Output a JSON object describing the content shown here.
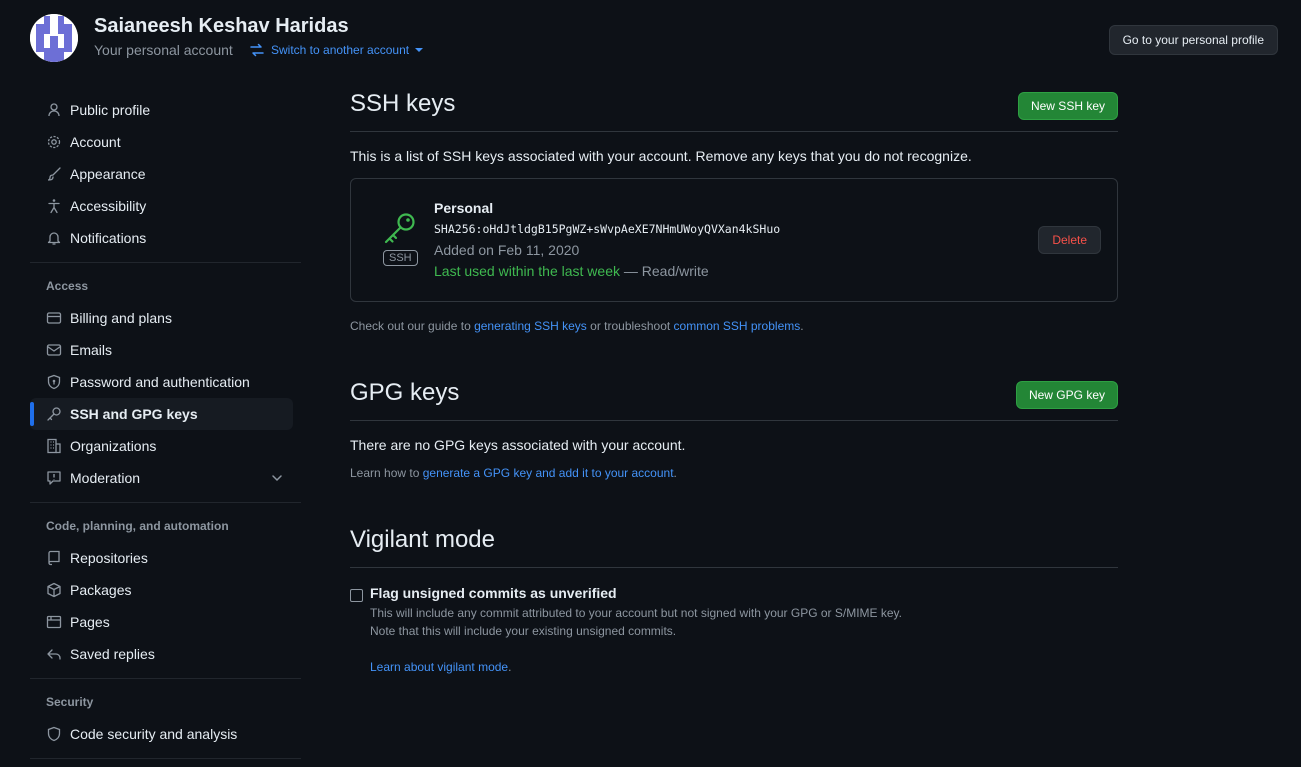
{
  "header": {
    "account_name": "Saianeesh Keshav Haridas",
    "account_sub": "Your personal account",
    "switch_label": "Switch to another account",
    "profile_button": "Go to your personal profile"
  },
  "sidebar": {
    "top_items": [
      {
        "label": "Public profile",
        "icon": "person-icon"
      },
      {
        "label": "Account",
        "icon": "gear-icon"
      },
      {
        "label": "Appearance",
        "icon": "paintbrush-icon"
      },
      {
        "label": "Accessibility",
        "icon": "accessibility-icon"
      },
      {
        "label": "Notifications",
        "icon": "bell-icon"
      }
    ],
    "access_heading": "Access",
    "access_items": [
      {
        "label": "Billing and plans",
        "icon": "credit-card-icon"
      },
      {
        "label": "Emails",
        "icon": "mail-icon"
      },
      {
        "label": "Password and authentication",
        "icon": "shield-lock-icon"
      },
      {
        "label": "SSH and GPG keys",
        "icon": "key-icon",
        "active": true
      },
      {
        "label": "Organizations",
        "icon": "organization-icon"
      },
      {
        "label": "Moderation",
        "icon": "report-icon"
      }
    ],
    "code_heading": "Code, planning, and automation",
    "code_items": [
      {
        "label": "Repositories",
        "icon": "repo-icon"
      },
      {
        "label": "Packages",
        "icon": "package-icon"
      },
      {
        "label": "Pages",
        "icon": "browser-icon"
      },
      {
        "label": "Saved replies",
        "icon": "reply-icon"
      }
    ],
    "security_heading": "Security",
    "security_items": [
      {
        "label": "Code security and analysis",
        "icon": "shield-icon"
      }
    ]
  },
  "ssh": {
    "title": "SSH keys",
    "new_button": "New SSH key",
    "description": "This is a list of SSH keys associated with your account. Remove any keys that you do not recognize.",
    "key": {
      "name": "Personal",
      "fingerprint": "SHA256:oHdJtldgB15PgWZ+sWvpAeXE7NHmUWoyQVXan4kSHuo",
      "added": "Added on Feb 11, 2020",
      "last_used": "Last used within the last week",
      "access": " — Read/write",
      "type_label": "SSH",
      "delete_button": "Delete"
    },
    "note_prefix": "Check out our guide to ",
    "note_link1": "generating SSH keys",
    "note_mid": " or troubleshoot ",
    "note_link2": "common SSH problems",
    "note_suffix": "."
  },
  "gpg": {
    "title": "GPG keys",
    "new_button": "New GPG key",
    "description": "There are no GPG keys associated with your account.",
    "note_prefix": "Learn how to ",
    "note_link": "generate a GPG key and add it to your account",
    "note_suffix": "."
  },
  "vigilant": {
    "title": "Vigilant mode",
    "checkbox_label": "Flag unsigned commits as unverified",
    "note1": "This will include any commit attributed to your account but not signed with your GPG or S/MIME key.",
    "note2": "Note that this will include your existing unsigned commits.",
    "learn_link": "Learn about vigilant mode",
    "learn_suffix": "."
  }
}
